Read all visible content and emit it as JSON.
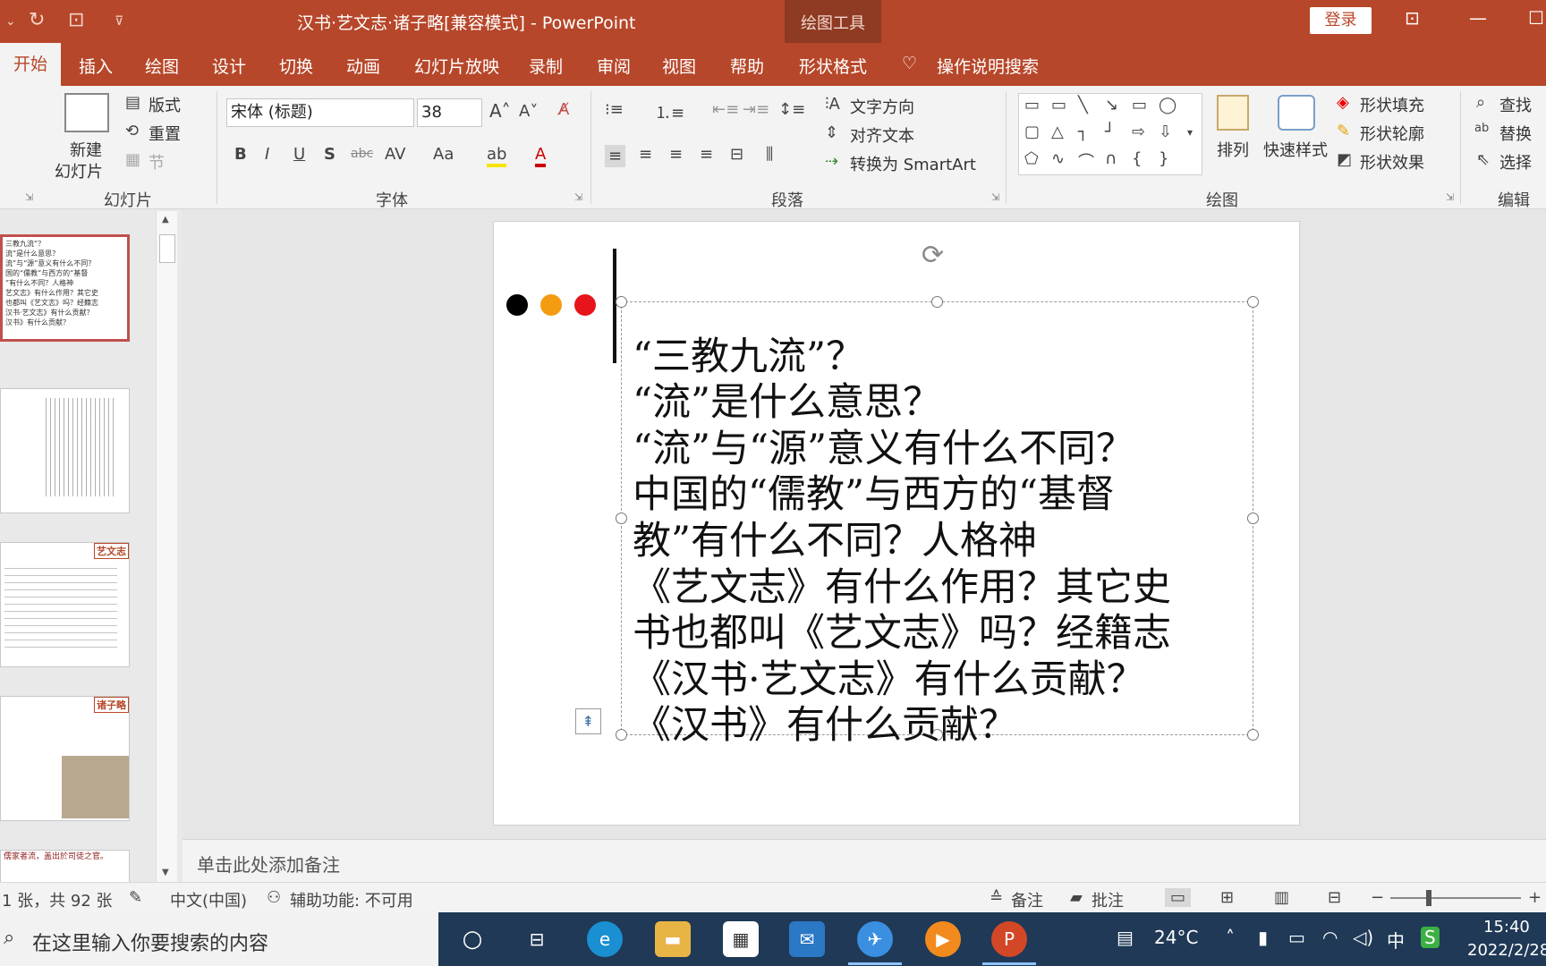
{
  "titlebar": {
    "title": "汉书·艺文志·诸子略[兼容模式] - PowerPoint",
    "contextual_group": "绘图工具",
    "login_label": "登录"
  },
  "tabs": [
    "开始",
    "插入",
    "绘图",
    "设计",
    "切换",
    "动画",
    "幻灯片放映",
    "录制",
    "审阅",
    "视图",
    "帮助",
    "形状格式"
  ],
  "search_hint": "操作说明搜索",
  "ribbon": {
    "slides": {
      "new_slide_line1": "新建",
      "new_slide_line2": "幻灯片",
      "layout": "版式",
      "reset": "重置",
      "section": "节",
      "group_label": "幻灯片"
    },
    "font": {
      "font_name": "宋体 (标题)",
      "font_size": "38",
      "aa_label": "Aa",
      "group_label": "字体"
    },
    "paragraph": {
      "text_direction": "文字方向",
      "align_text": "对齐文本",
      "convert_smartart": "转换为 SmartArt",
      "group_label": "段落"
    },
    "drawing": {
      "arrange": "排列",
      "quick_styles": "快速样式",
      "shape_fill": "形状填充",
      "shape_outline": "形状轮廓",
      "shape_effects": "形状效果",
      "group_label": "绘图"
    },
    "editing": {
      "find": "查找",
      "replace": "替换",
      "select": "选择",
      "group_label": "编辑"
    }
  },
  "thumbnails": {
    "slide1_text": "三教九流”？\n流”是什么意思？\n流”与“源”意义有什么不同？\n国的“儒教”与西方的“基督\n”有什么不同？人格神\n艺文志》有什么作用？其它史\n也都叫《艺文志》吗？经籍志\n汉书·艺文志》有什么贡献？\n汉书》有什么贡献？",
    "slide3_tag": "艺文志",
    "slide4_tag": "诸子略",
    "slide5_text": "儒家者流，盖出於司徒之官。"
  },
  "slide": {
    "lines": [
      "“三教九流”？",
      "“流”是什么意思？",
      "“流”与“源”意义有什么不同？",
      "中国的“儒教”与西方的“基督",
      "教”有什么不同？人格神",
      "《艺文志》有什么作用？其它史",
      "书也都叫《艺文志》吗？经籍志",
      "《汉书·艺文志》有什么贡献？",
      "《汉书》有什么贡献？"
    ],
    "dot_colors": [
      "#000000",
      "#f39c12",
      "#e8141b"
    ]
  },
  "notes_placeholder": "单击此处添加备注",
  "statusbar": {
    "slide_count": "1 张，共 92 张",
    "language": "中文(中国)",
    "accessibility": "辅助功能: 不可用",
    "notes": "备注",
    "comments": "批注"
  },
  "taskbar": {
    "search_placeholder": "在这里输入你要搜索的内容",
    "temperature": "24°C",
    "ime": "中",
    "time": "15:40",
    "date": "2022/2/28"
  },
  "colors": {
    "accent": "#b7472a",
    "taskbar": "#1f3956"
  }
}
